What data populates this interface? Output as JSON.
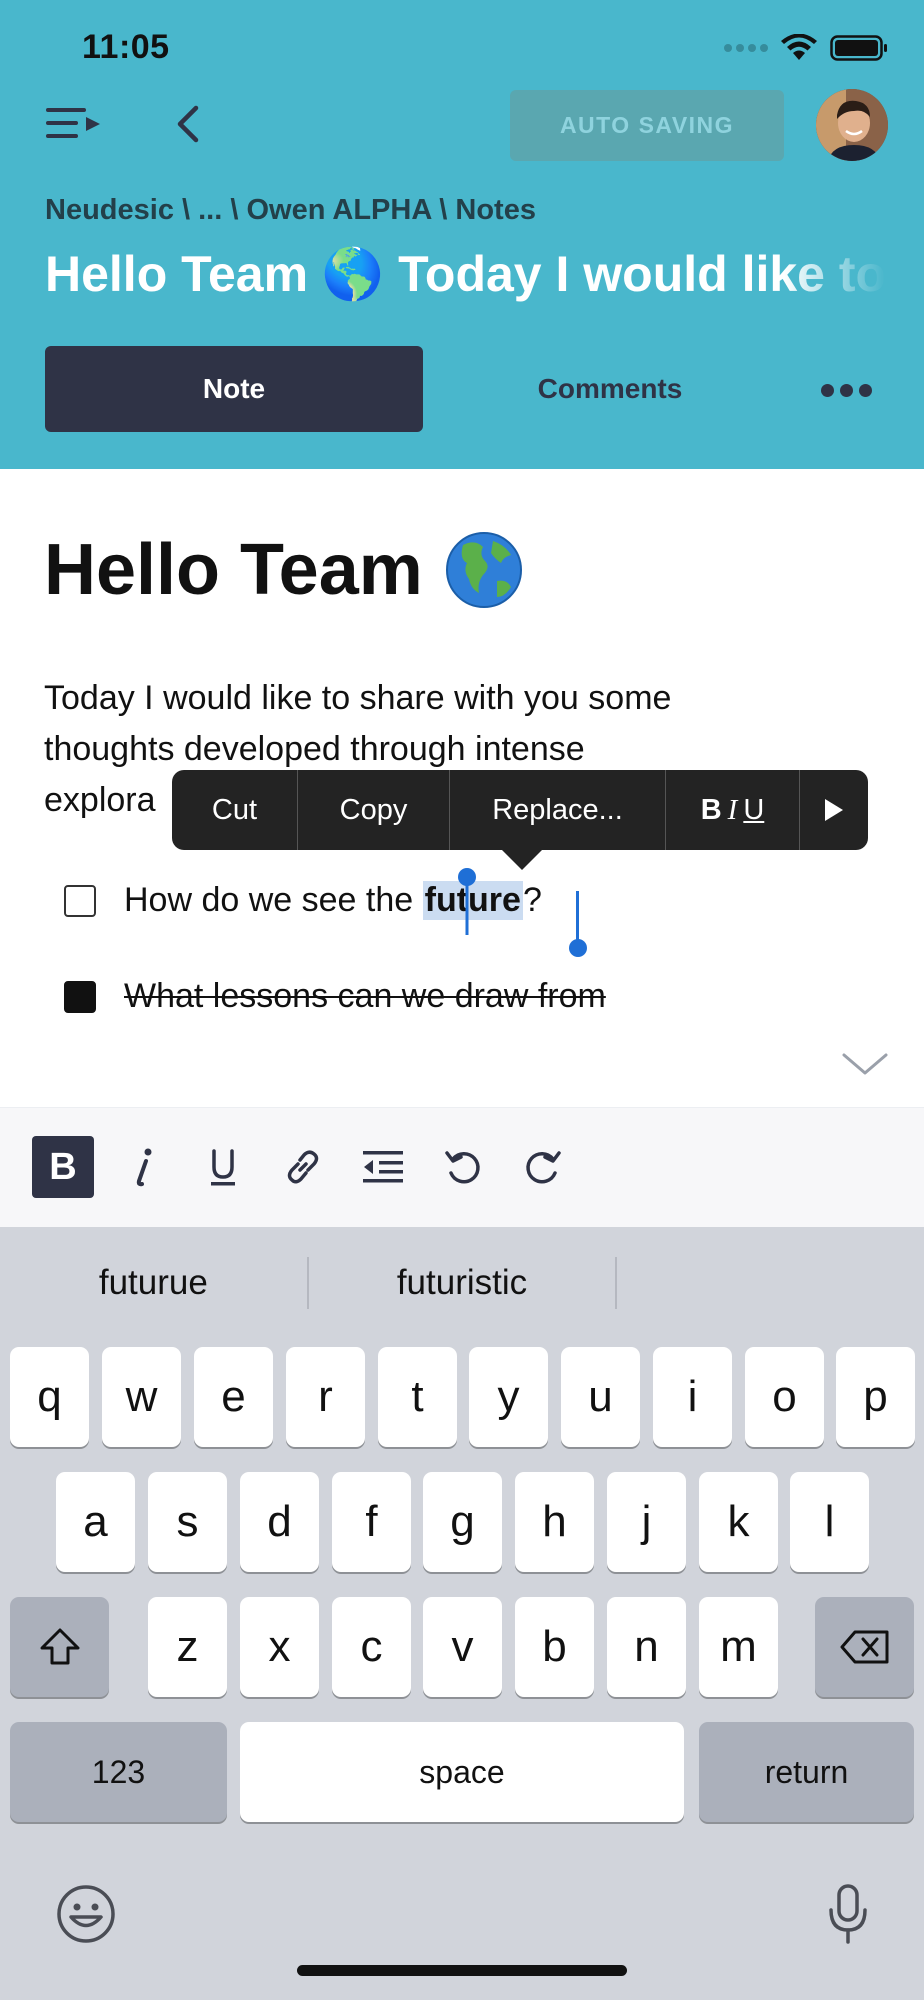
{
  "status": {
    "time": "11:05"
  },
  "header": {
    "autosave_label": "AUTO SAVING",
    "breadcrumb": "Neudesic \\ ... \\ Owen ALPHA \\ Notes",
    "title": "Hello Team 🌎 Today I would like to share with you some thoughts",
    "tabs": [
      {
        "label": "Note"
      },
      {
        "label": "Comments"
      }
    ]
  },
  "note": {
    "heading": "Hello Team",
    "paragraph_line1": "Today I would like to share with you some",
    "paragraph_line2": "thoughts developed through intense",
    "paragraph_line3": "explora",
    "task1_before": "How do we see the ",
    "task1_selected": "future",
    "task1_after": "?",
    "task2": "What lessons can we draw from"
  },
  "context_menu": {
    "items": [
      "Cut",
      "Copy",
      "Replace...",
      "B",
      "I",
      "U"
    ]
  },
  "keyboard": {
    "suggestions": [
      "futurue",
      "futuristic",
      ""
    ],
    "row1": [
      "q",
      "w",
      "e",
      "r",
      "t",
      "y",
      "u",
      "i",
      "o",
      "p"
    ],
    "row2": [
      "a",
      "s",
      "d",
      "f",
      "g",
      "h",
      "j",
      "k",
      "l"
    ],
    "row3": [
      "z",
      "x",
      "c",
      "v",
      "b",
      "n",
      "m"
    ],
    "numbers_label": "123",
    "space_label": "space",
    "return_label": "return"
  },
  "colors": {
    "header_bg": "#49b7cc",
    "dark_navy": "#2f3346",
    "selection_blue": "#1f6fd6",
    "keyboard_bg": "#d1d4db"
  }
}
